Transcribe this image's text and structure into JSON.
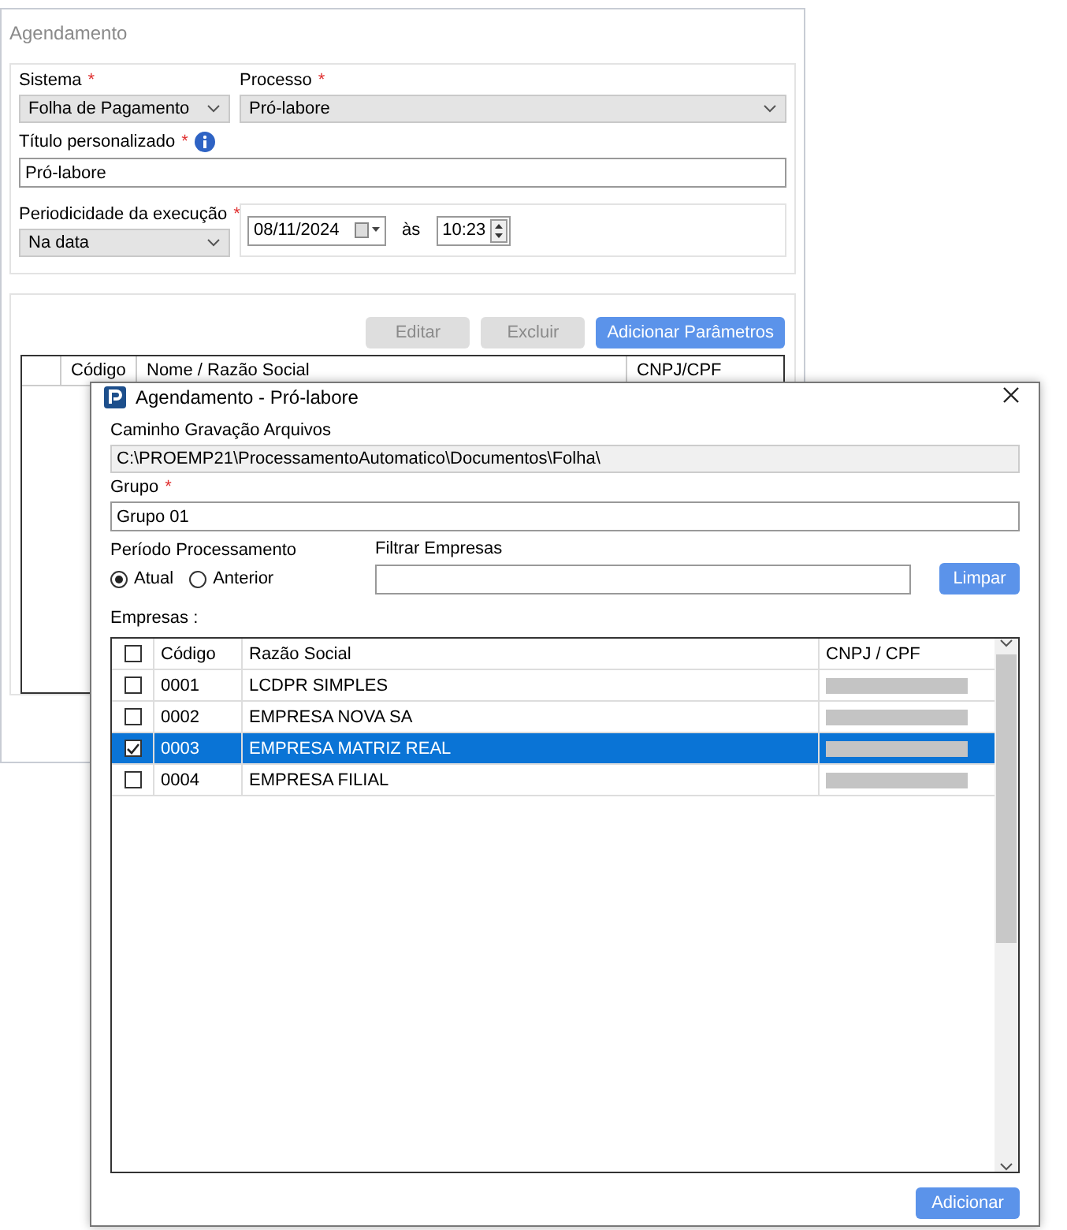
{
  "main_window": {
    "title": "Agendamento",
    "sistema": {
      "label": "Sistema",
      "required_mark": "*",
      "value": "Folha de Pagamento"
    },
    "processo": {
      "label": "Processo",
      "required_mark": "*",
      "value": "Pró-labore"
    },
    "titulo": {
      "label": "Título personalizado",
      "required_mark": "*",
      "value": "Pró-labore"
    },
    "periodicidade": {
      "label": "Periodicidade da execução",
      "required_mark": "*",
      "value": "Na data"
    },
    "date": "08/11/2024",
    "time_label": "às",
    "time": "10:23",
    "buttons": [
      {
        "label": "Editar",
        "disabled": true
      },
      {
        "label": "Excluir",
        "disabled": true
      },
      {
        "label": "Adicionar Parâmetros",
        "disabled": false
      }
    ],
    "table": {
      "columns": [
        "Código",
        "Nome / Razão Social",
        "CNPJ/CPF"
      ]
    }
  },
  "dialog": {
    "title": "Agendamento - Pró-labore",
    "caminho": {
      "label": "Caminho Gravação Arquivos",
      "value": "C:\\PROEMP21\\ProcessamentoAutomatico\\Documentos\\Folha\\"
    },
    "grupo": {
      "label": "Grupo",
      "required_mark": "*",
      "value": "Grupo 01"
    },
    "periodo": {
      "label": "Período Processamento",
      "options": [
        {
          "label": "Atual",
          "selected": true
        },
        {
          "label": "Anterior",
          "selected": false
        }
      ]
    },
    "filtrar": {
      "label": "Filtrar Empresas",
      "button": "Limpar"
    },
    "empresas_label": "Empresas :",
    "table": {
      "header_checked": false,
      "columns": [
        "Código",
        "Razão Social",
        "CNPJ / CPF"
      ],
      "rows": [
        {
          "codigo": "0001",
          "razao": "LCDPR SIMPLES",
          "checked": false,
          "selected": false
        },
        {
          "codigo": "0002",
          "razao": "EMPRESA NOVA SA",
          "checked": false,
          "selected": false
        },
        {
          "codigo": "0003",
          "razao": "EMPRESA MATRIZ REAL",
          "checked": true,
          "selected": true
        },
        {
          "codigo": "0004",
          "razao": "EMPRESA FILIAL",
          "checked": false,
          "selected": false
        }
      ]
    },
    "add_button": "Adicionar"
  }
}
